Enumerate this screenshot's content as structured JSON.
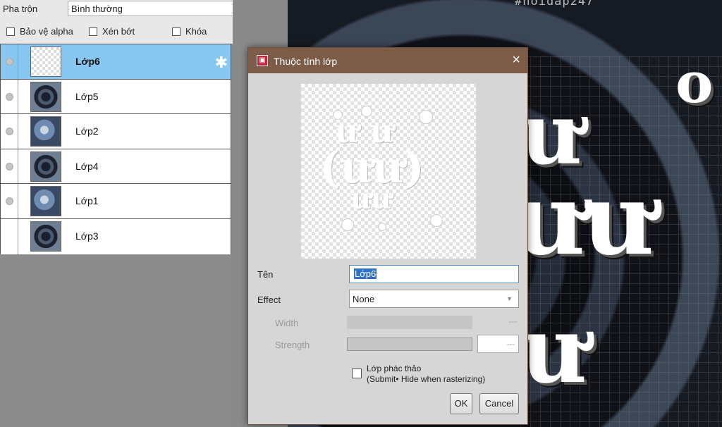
{
  "blend": {
    "label": "Pha trộn",
    "value": "Bình thường"
  },
  "options": [
    {
      "label": "Bảo vệ alpha"
    },
    {
      "label": "Xén bớt"
    },
    {
      "label": "Khóa"
    }
  ],
  "layers": [
    {
      "name": "Lớp6",
      "selected": true
    },
    {
      "name": "Lớp5"
    },
    {
      "name": "Lớp2"
    },
    {
      "name": "Lớp4"
    },
    {
      "name": "Lớp1"
    },
    {
      "name": "Lớp3"
    }
  ],
  "canvas": {
    "tag": "#hoidap247"
  },
  "dialog": {
    "title": "Thuộc tính lớp",
    "close_icon": "×",
    "name_label": "Tên",
    "name_value": "Lớp6",
    "effect_label": "Effect",
    "effect_value": "None",
    "width_label": "Width",
    "width_value": "---",
    "strength_label": "Strength",
    "strength_value": "---",
    "draft_line1": "Lớp phác thảo",
    "draft_line2": "(Submit• Hide when rasterizing)",
    "ok_label": "OK",
    "cancel_label": "Cancel"
  },
  "colors": {
    "selected_row": "#88c8f0",
    "titlebar": "#7c5b47",
    "selection": "#2f73c9"
  }
}
